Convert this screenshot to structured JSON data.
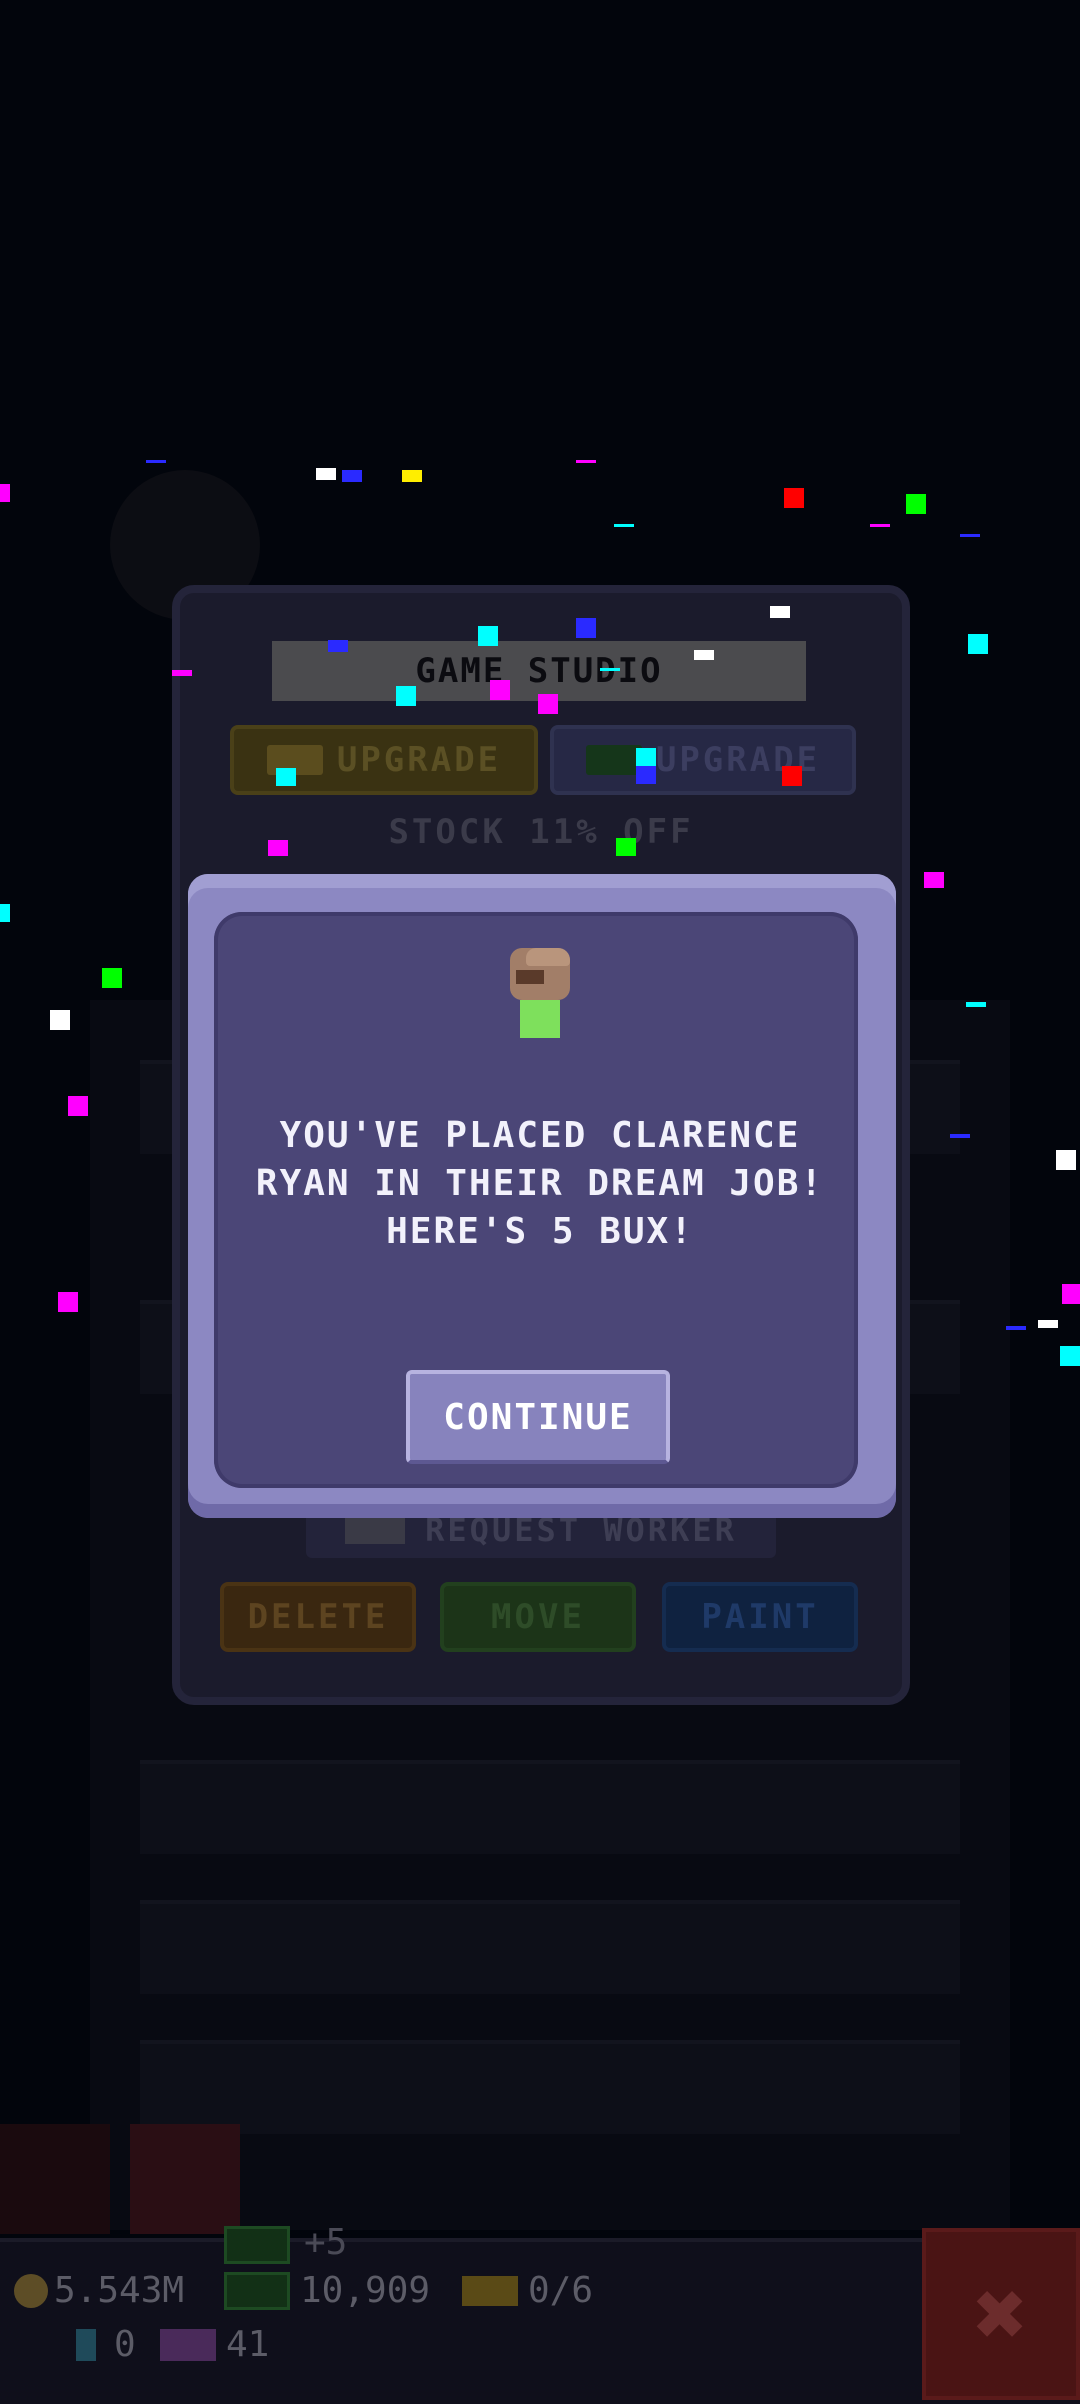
{
  "back_panel": {
    "title": "GAME STUDIO",
    "upgrade_coin_label": "UPGRADE",
    "upgrade_bux_label": "UPGRADE",
    "stock_text": "STOCK 11% OFF",
    "request_worker_label": "REQUEST WORKER",
    "delete_label": "DELETE",
    "move_label": "MOVE",
    "paint_label": "PAINT"
  },
  "modal": {
    "message": "YOU'VE PLACED CLARENCE RYAN IN THEIR DREAM JOB! HERE'S 5 BUX!",
    "continue_label": "CONTINUE"
  },
  "bottom_bar": {
    "coins": "5.543M",
    "bux": "10,909",
    "bux_gain": "+5",
    "tickets": "0/6",
    "gems": "0",
    "vip": "41"
  },
  "colors": {
    "modal_frame": "#8c88c2",
    "modal_inner": "#4b4677",
    "continue_button": "#8783bd",
    "background": "#02050c"
  },
  "icons": [
    "coin-icon",
    "bux-icon",
    "ticket-icon",
    "gem-icon",
    "vip-icon",
    "close-icon",
    "worker-avatar"
  ]
}
